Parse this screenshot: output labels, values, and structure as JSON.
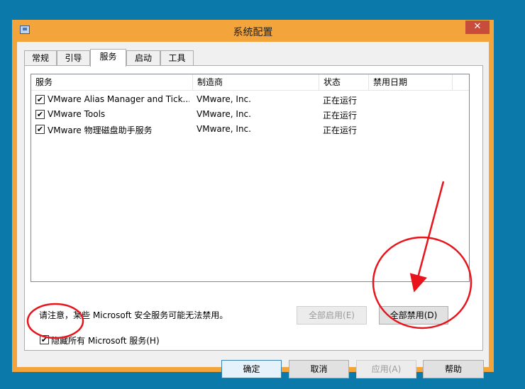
{
  "window": {
    "title": "系统配置",
    "close_symbol": "✕"
  },
  "tabs": [
    "常规",
    "引导",
    "服务",
    "启动",
    "工具"
  ],
  "active_tab": "服务",
  "services": {
    "columns": [
      "服务",
      "制造商",
      "状态",
      "禁用日期"
    ],
    "rows": [
      {
        "checked": "✔",
        "name": "VMware Alias Manager and Tick...",
        "maker": "VMware, Inc.",
        "status": "正在运行",
        "date": ""
      },
      {
        "checked": "✔",
        "name": "VMware Tools",
        "maker": "VMware, Inc.",
        "status": "正在运行",
        "date": ""
      },
      {
        "checked": "✔",
        "name": "VMware 物理磁盘助手服务",
        "maker": "VMware, Inc.",
        "status": "正在运行",
        "date": ""
      }
    ]
  },
  "note": "请注意，某些 Microsoft 安全服务可能无法禁用。",
  "enable_all_label": "全部启用(E)",
  "disable_all_label": "全部禁用(D)",
  "hide_ms": {
    "checked": "✔",
    "label": "隐藏所有 Microsoft 服务(H)"
  },
  "footer": {
    "ok": "确定",
    "cancel": "取消",
    "apply": "应用(A)",
    "help": "帮助"
  },
  "annotation_color": "#e8141b"
}
